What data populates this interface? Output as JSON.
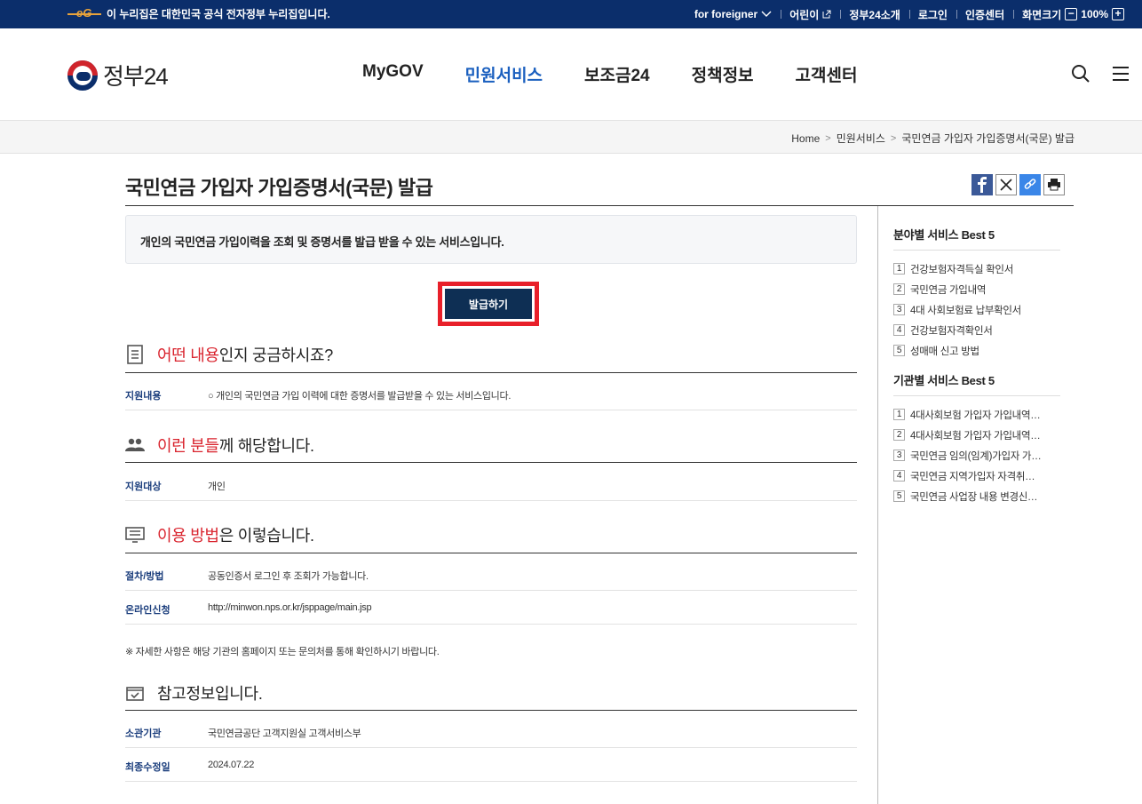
{
  "topbar": {
    "notice": "이 누리집은 대한민국 공식 전자정부 누리집입니다.",
    "foreigner": "for foreigner",
    "kids": "어린이",
    "intro24": "정부24소개",
    "login": "로그인",
    "cert": "인증센터",
    "zoom_label": "화면크기",
    "zoom_value": "100%"
  },
  "header": {
    "logo_text": "정부24",
    "nav": [
      "MyGOV",
      "민원서비스",
      "보조금24",
      "정책정보",
      "고객센터"
    ],
    "active_index": 1
  },
  "breadcrumb": [
    "Home",
    "민원서비스",
    "국민연금 가입자 가입증명서(국문) 발급"
  ],
  "page": {
    "title": "국민연금 가입자 가입증명서(국문) 발급",
    "intro": "개인의 국민연금 가입이력을 조회 및 증명서를 발급 받을 수 있는 서비스입니다.",
    "issue_button": "발급하기"
  },
  "sections": {
    "what": {
      "highlight": "어떤 내용",
      "rest": "인지 궁금하시죠?",
      "rows": [
        {
          "key": "지원내용",
          "value": "○ 개인의 국민연금 가입 이력에 대한 증명서를 발급받을 수 있는 서비스입니다."
        }
      ]
    },
    "who": {
      "highlight": "이런 분들",
      "rest": "께 해당합니다.",
      "rows": [
        {
          "key": "지원대상",
          "value": "개인"
        }
      ]
    },
    "how": {
      "highlight": "이용 방법",
      "rest": "은 이렇습니다.",
      "rows": [
        {
          "key": "절차/방법",
          "value": "공동인증서 로그인 후 조회가 가능합니다."
        },
        {
          "key": "온라인신청",
          "value": "http://minwon.nps.or.kr/jsppage/main.jsp"
        }
      ]
    },
    "note": "※ 자세한 사항은 해당 기관의 홈페이지 또는 문의처를 통해 확인하시기 바랍니다.",
    "ref": {
      "title": "참고정보입니다.",
      "rows": [
        {
          "key": "소관기관",
          "value": "국민연금공단 고객지원실 고객서비스부"
        },
        {
          "key": "최종수정일",
          "value": "2024.07.22"
        }
      ]
    }
  },
  "sidebar": {
    "best_field": {
      "title": "분야별 서비스 Best 5",
      "items": [
        "건강보험자격득실 확인서",
        "국민연금 가입내역",
        "4대 사회보험료 납부확인서",
        "건강보험자격확인서",
        "성매매 신고 방법"
      ]
    },
    "best_org": {
      "title": "기관별 서비스 Best 5",
      "items": [
        "4대사회보험 가입자 가입내역 …",
        "4대사회보험 가입자 가입내역 …",
        "국민연금 임의(임계)가입자 가…",
        "국민연금 지역가입자 자격취득…",
        "국민연금 사업장 내용 변경신…"
      ]
    }
  },
  "colors": {
    "topbar_bg": "#0b2e6b",
    "nav_active": "#1a5fbf",
    "highlight_red": "#d9232d",
    "issue_button_bg": "#0e2f54",
    "issue_outline": "#e8202a"
  }
}
